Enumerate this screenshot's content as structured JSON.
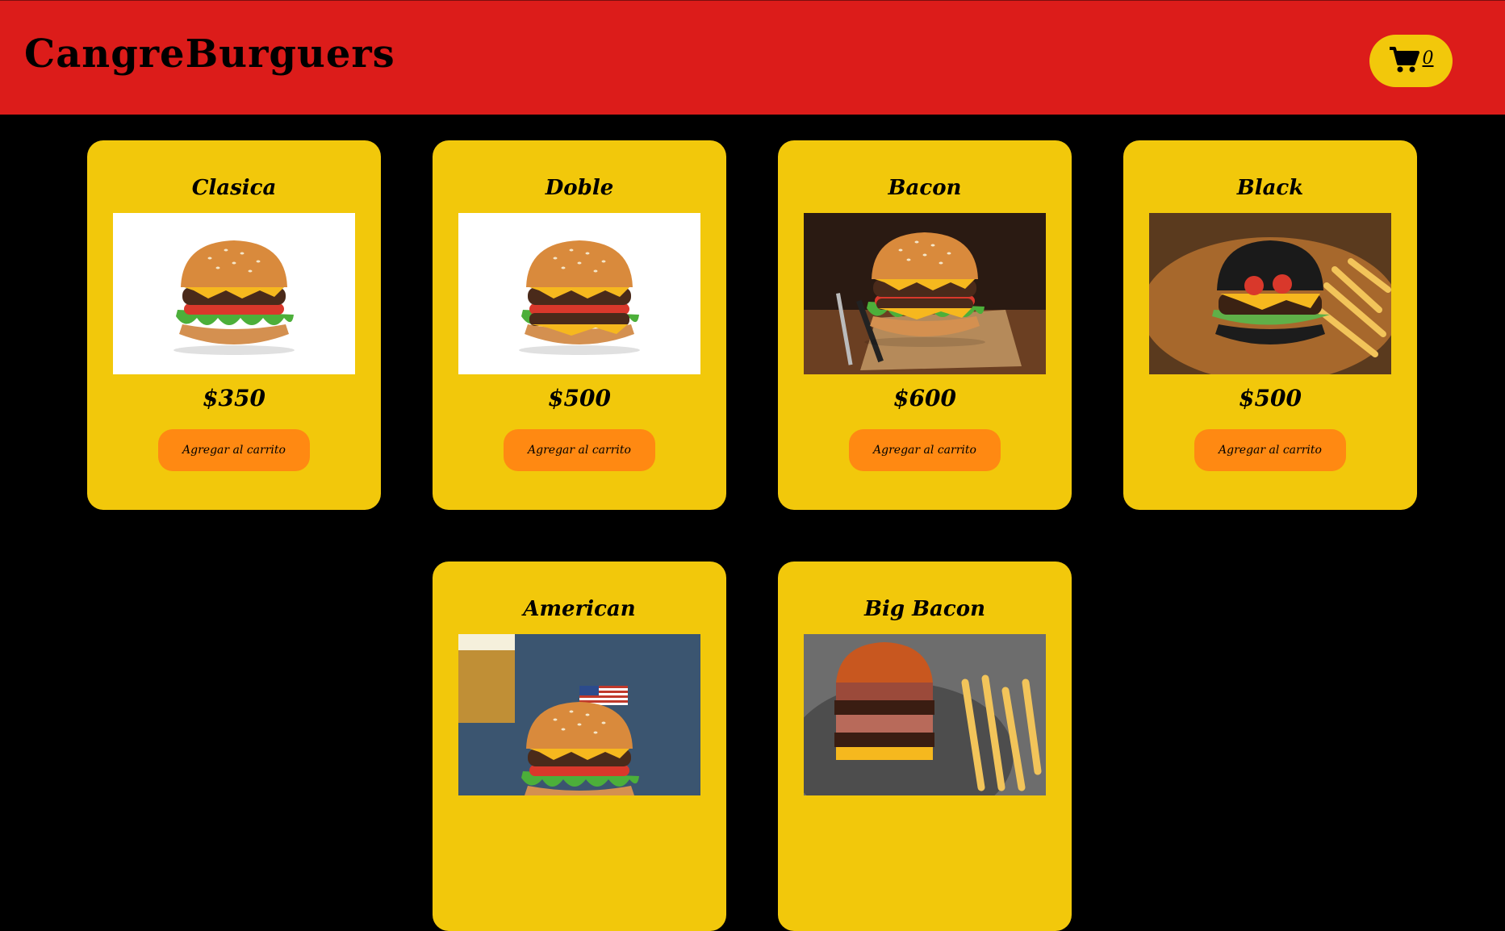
{
  "header": {
    "brand": "CangreBurguers",
    "cart": {
      "icon": "cart-icon",
      "count": "0"
    }
  },
  "colors": {
    "header_bg": "#dc1c1a",
    "page_bg": "#000000",
    "card_bg": "#f2c80b",
    "button_bg": "#ff8912"
  },
  "products": [
    {
      "name": "Clasica",
      "price": "$350",
      "button": "Agregar al carrito"
    },
    {
      "name": "Doble",
      "price": "$500",
      "button": "Agregar al carrito"
    },
    {
      "name": "Bacon",
      "price": "$600",
      "button": "Agregar al carrito"
    },
    {
      "name": "Black",
      "price": "$500",
      "button": "Agregar al carrito"
    },
    {
      "name": "American",
      "price": "",
      "button": ""
    },
    {
      "name": "Big Bacon",
      "price": "",
      "button": ""
    }
  ]
}
